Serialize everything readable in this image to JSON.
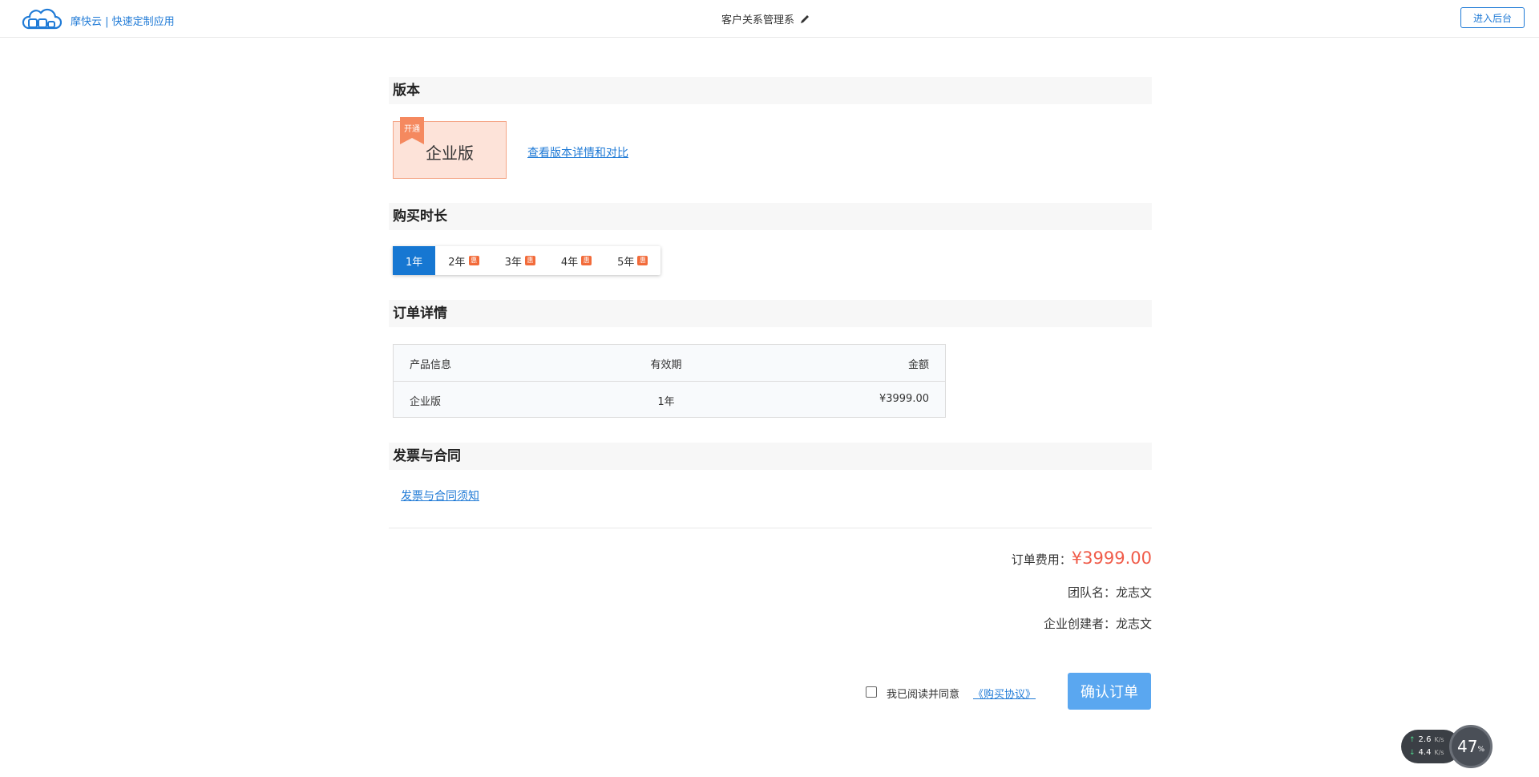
{
  "header": {
    "brand": "摩快云 | 快速定制应用",
    "app_title": "客户关系管理系",
    "enter_button": "进入后台"
  },
  "sections": {
    "edition": "版本",
    "duration": "购买时长",
    "order": "订单详情",
    "invoice": "发票与合同"
  },
  "edition": {
    "name": "企业版",
    "ribbon": "开通",
    "compare_link": "查看版本详情和对比"
  },
  "duration_options": [
    {
      "label": "1年",
      "badge": "",
      "active": true
    },
    {
      "label": "2年",
      "badge": "惠",
      "active": false
    },
    {
      "label": "3年",
      "badge": "惠",
      "active": false
    },
    {
      "label": "4年",
      "badge": "惠",
      "active": false
    },
    {
      "label": "5年",
      "badge": "惠",
      "active": false
    }
  ],
  "order_table": {
    "headers": [
      "产品信息",
      "有效期",
      "金额"
    ],
    "row": [
      "企业版",
      "1年",
      "¥3999.00"
    ]
  },
  "invoice_link": "发票与合同须知",
  "summary": {
    "fee_label": "订单费用：",
    "fee_value": "¥3999.00",
    "team_label": "团队名：",
    "team_value": "龙志文",
    "creator_label": "企业创建者：",
    "creator_value": "龙志文"
  },
  "agreement": {
    "text": "我已阅读并同意",
    "link": "《购买协议》",
    "checked": false
  },
  "confirm_button": "确认订单",
  "net_widget": {
    "up": "2.6",
    "down": "4.4",
    "unit": "K/s",
    "percent": "47",
    "percent_sign": "%"
  },
  "colors": {
    "accent": "#1677d2",
    "price": "#f05c4a",
    "edition_bg": "#fde3d9",
    "badge": "#f26b3a"
  }
}
